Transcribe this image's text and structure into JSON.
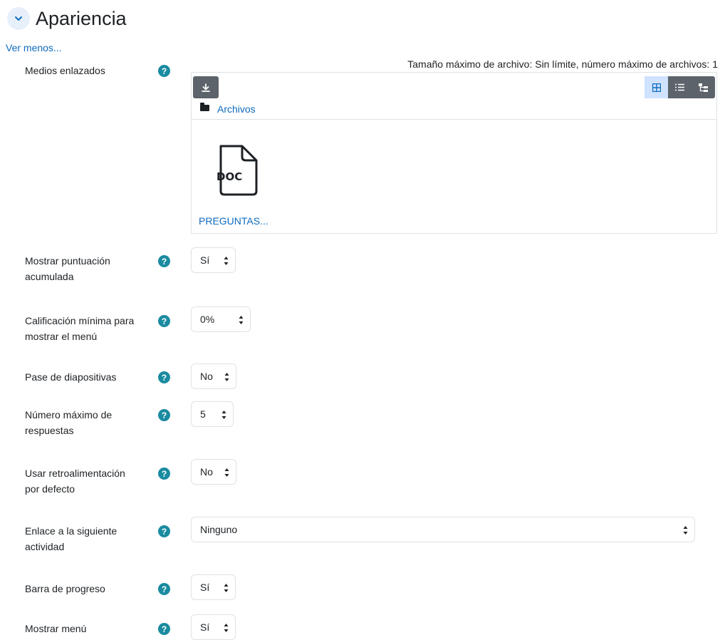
{
  "section": {
    "title": "Apariencia",
    "collapse_icon": "chevron-down-icon"
  },
  "ver_menos": "Ver menos...",
  "linked_media": {
    "label": "Medios enlazados",
    "info": "Tamaño máximo de archivo: Sin límite, número máximo de archivos: 1",
    "path_link": "Archivos",
    "file": {
      "type": "DOC",
      "name": "PREGUNTAS..."
    }
  },
  "fields": [
    {
      "label_lines": [
        "Mostrar puntuación",
        "acumulada"
      ],
      "value": "Sí"
    },
    {
      "label_lines": [
        "Calificación mínima para",
        "mostrar el menú"
      ],
      "value": "0%"
    },
    {
      "label_lines": [
        "Pase de diapositivas"
      ],
      "value": "No"
    },
    {
      "label_lines": [
        "Número máximo de",
        "respuestas"
      ],
      "value": "5"
    },
    {
      "label_lines": [
        "Usar retroalimentación",
        "por defecto"
      ],
      "value": "No"
    },
    {
      "label_lines": [
        "Enlace a la siguiente",
        "actividad"
      ],
      "value": "Ninguno"
    },
    {
      "label_lines": [
        "Barra de progreso"
      ],
      "value": "Sí"
    },
    {
      "label_lines": [
        "Mostrar menú"
      ],
      "value": "Sí"
    }
  ],
  "help_symbol": "?",
  "colors": {
    "link": "#0f6cbf",
    "help": "#1a8ba0",
    "dark_button": "#5c636a",
    "active_view": "#cfe2ff"
  }
}
